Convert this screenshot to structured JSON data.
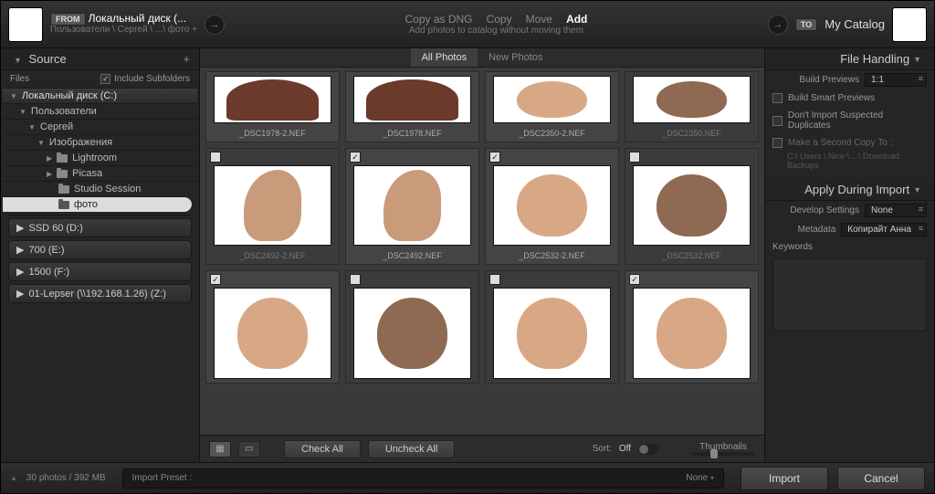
{
  "top": {
    "from_badge": "FROM",
    "to_badge": "TO",
    "source_title": "Локальный диск (...",
    "source_path": "Пользователи \\ Сергей \\ ...\\ фото +",
    "dest_title": "My Catalog",
    "modes": {
      "dng": "Copy as DNG",
      "copy": "Copy",
      "move": "Move",
      "add": "Add"
    },
    "mode_sub": "Add photos to catalog without moving them"
  },
  "left": {
    "header": "Source",
    "files_label": "Files",
    "include_sub": "Include Subfolders",
    "tree": {
      "root": "Локальный диск (C:)",
      "n1": "Пользователи",
      "n2": "Сергей",
      "n3": "Изображения",
      "n4a": "Lightroom",
      "n4b": "Picasa",
      "n4c": "Studio Session",
      "n4d": "фото"
    },
    "drives": [
      "SSD 60 (D:)",
      "700 (E:)",
      "1500 (F:)",
      "01-Lepser (\\\\192.168.1.26) (Z:)"
    ]
  },
  "tabs": {
    "all": "All Photos",
    "new": "New Photos"
  },
  "thumbs": [
    {
      "file": "_DSC1978-2.NEF",
      "checked": true
    },
    {
      "file": "_DSC1978.NEF",
      "checked": true
    },
    {
      "file": "_DSC2350-2.NEF",
      "checked": true
    },
    {
      "file": "_DSC2350.NEF",
      "checked": false
    },
    {
      "file": "_DSC2492-2.NEF",
      "checked": false
    },
    {
      "file": "_DSC2492.NEF",
      "checked": true
    },
    {
      "file": "_DSC2532-2.NEF",
      "checked": true
    },
    {
      "file": "_DSC2532.NEF",
      "checked": false
    },
    {
      "file": "",
      "checked": true
    },
    {
      "file": "",
      "checked": false
    },
    {
      "file": "",
      "checked": false
    },
    {
      "file": "",
      "checked": true
    }
  ],
  "ctool": {
    "check_all": "Check All",
    "uncheck_all": "Uncheck All",
    "sort_label": "Sort:",
    "sort_value": "Off",
    "thumb_label": "Thumbnails"
  },
  "right": {
    "fh_header": "File Handling",
    "build_previews_label": "Build Previews",
    "build_previews_value": "1:1",
    "smart": "Build Smart Previews",
    "dup": "Don't Import Suspected Duplicates",
    "copy2": "Make a Second Copy To :",
    "copy2_path": "C:\\ Users \\ Nice \\ ...\\ Download Backups",
    "adi_header": "Apply During Import",
    "dev_label": "Develop Settings",
    "dev_value": "None",
    "meta_label": "Metadata",
    "meta_value": "Копирайт Анна",
    "keywords_label": "Keywords"
  },
  "bottom": {
    "stats": "30 photos / 392 MB",
    "preset_label": "Import Preset :",
    "preset_value": "None",
    "import": "Import",
    "cancel": "Cancel"
  }
}
